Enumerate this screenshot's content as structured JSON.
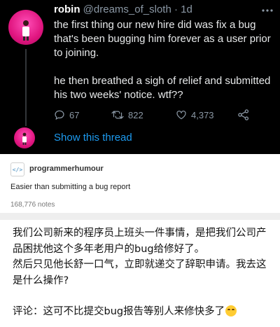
{
  "tweet": {
    "name": "robin",
    "handle": "@dreams_of_sloth",
    "separator": "·",
    "time": "1d",
    "text_1": "the first thing our new hire did was fix a bug that's been bugging him forever as a user prior to joining.",
    "text_2": "he then breathed a sigh of relief and submitted his two weeks' notice. wtf??",
    "reply_count": "67",
    "retweet_count": "822",
    "like_count": "4,373",
    "show_thread": "Show this thread",
    "link_color": "#1d9bf0",
    "avatar_color": "#e0157f"
  },
  "post": {
    "avatar_icon": "</>",
    "username": "programmerhumour",
    "text": "Easier than submitting a bug report",
    "notes": "168,776 notes"
  },
  "caption": {
    "line_1": "我们公司新来的程序员上班头一件事情，是把我们公司产品困扰他这个多年老用户的bug给修好了。",
    "line_2": "然后只见他长舒一口气，立即就递交了辞职申请。我去这是什么操作?",
    "comment": "评论：这可不比提交bug报告等别人来修快多了",
    "emoji_icon": "sweat-grin-emoji-icon"
  }
}
